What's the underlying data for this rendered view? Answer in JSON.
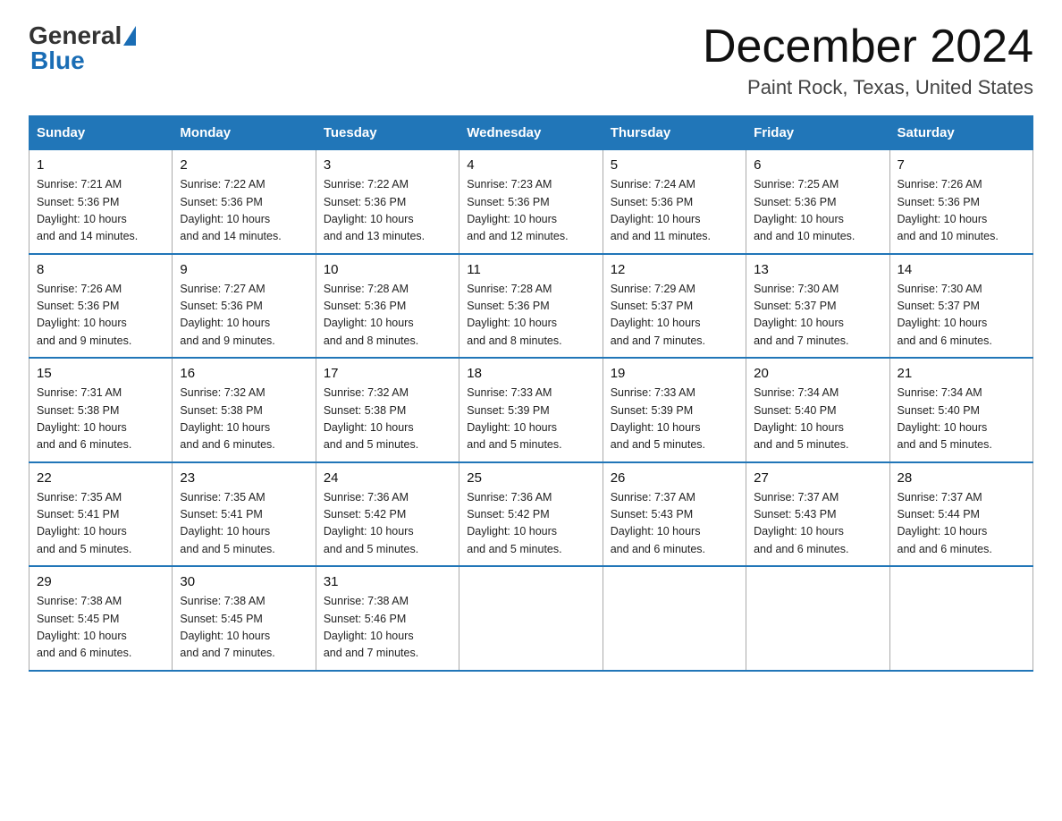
{
  "logo": {
    "text_general": "General",
    "text_blue": "Blue"
  },
  "header": {
    "month": "December 2024",
    "location": "Paint Rock, Texas, United States"
  },
  "weekdays": [
    "Sunday",
    "Monday",
    "Tuesday",
    "Wednesday",
    "Thursday",
    "Friday",
    "Saturday"
  ],
  "weeks": [
    [
      {
        "day": "1",
        "sunrise": "7:21 AM",
        "sunset": "5:36 PM",
        "daylight": "10 hours and 14 minutes."
      },
      {
        "day": "2",
        "sunrise": "7:22 AM",
        "sunset": "5:36 PM",
        "daylight": "10 hours and 14 minutes."
      },
      {
        "day": "3",
        "sunrise": "7:22 AM",
        "sunset": "5:36 PM",
        "daylight": "10 hours and 13 minutes."
      },
      {
        "day": "4",
        "sunrise": "7:23 AM",
        "sunset": "5:36 PM",
        "daylight": "10 hours and 12 minutes."
      },
      {
        "day": "5",
        "sunrise": "7:24 AM",
        "sunset": "5:36 PM",
        "daylight": "10 hours and 11 minutes."
      },
      {
        "day": "6",
        "sunrise": "7:25 AM",
        "sunset": "5:36 PM",
        "daylight": "10 hours and 10 minutes."
      },
      {
        "day": "7",
        "sunrise": "7:26 AM",
        "sunset": "5:36 PM",
        "daylight": "10 hours and 10 minutes."
      }
    ],
    [
      {
        "day": "8",
        "sunrise": "7:26 AM",
        "sunset": "5:36 PM",
        "daylight": "10 hours and 9 minutes."
      },
      {
        "day": "9",
        "sunrise": "7:27 AM",
        "sunset": "5:36 PM",
        "daylight": "10 hours and 9 minutes."
      },
      {
        "day": "10",
        "sunrise": "7:28 AM",
        "sunset": "5:36 PM",
        "daylight": "10 hours and 8 minutes."
      },
      {
        "day": "11",
        "sunrise": "7:28 AM",
        "sunset": "5:36 PM",
        "daylight": "10 hours and 8 minutes."
      },
      {
        "day": "12",
        "sunrise": "7:29 AM",
        "sunset": "5:37 PM",
        "daylight": "10 hours and 7 minutes."
      },
      {
        "day": "13",
        "sunrise": "7:30 AM",
        "sunset": "5:37 PM",
        "daylight": "10 hours and 7 minutes."
      },
      {
        "day": "14",
        "sunrise": "7:30 AM",
        "sunset": "5:37 PM",
        "daylight": "10 hours and 6 minutes."
      }
    ],
    [
      {
        "day": "15",
        "sunrise": "7:31 AM",
        "sunset": "5:38 PM",
        "daylight": "10 hours and 6 minutes."
      },
      {
        "day": "16",
        "sunrise": "7:32 AM",
        "sunset": "5:38 PM",
        "daylight": "10 hours and 6 minutes."
      },
      {
        "day": "17",
        "sunrise": "7:32 AM",
        "sunset": "5:38 PM",
        "daylight": "10 hours and 5 minutes."
      },
      {
        "day": "18",
        "sunrise": "7:33 AM",
        "sunset": "5:39 PM",
        "daylight": "10 hours and 5 minutes."
      },
      {
        "day": "19",
        "sunrise": "7:33 AM",
        "sunset": "5:39 PM",
        "daylight": "10 hours and 5 minutes."
      },
      {
        "day": "20",
        "sunrise": "7:34 AM",
        "sunset": "5:40 PM",
        "daylight": "10 hours and 5 minutes."
      },
      {
        "day": "21",
        "sunrise": "7:34 AM",
        "sunset": "5:40 PM",
        "daylight": "10 hours and 5 minutes."
      }
    ],
    [
      {
        "day": "22",
        "sunrise": "7:35 AM",
        "sunset": "5:41 PM",
        "daylight": "10 hours and 5 minutes."
      },
      {
        "day": "23",
        "sunrise": "7:35 AM",
        "sunset": "5:41 PM",
        "daylight": "10 hours and 5 minutes."
      },
      {
        "day": "24",
        "sunrise": "7:36 AM",
        "sunset": "5:42 PM",
        "daylight": "10 hours and 5 minutes."
      },
      {
        "day": "25",
        "sunrise": "7:36 AM",
        "sunset": "5:42 PM",
        "daylight": "10 hours and 5 minutes."
      },
      {
        "day": "26",
        "sunrise": "7:37 AM",
        "sunset": "5:43 PM",
        "daylight": "10 hours and 6 minutes."
      },
      {
        "day": "27",
        "sunrise": "7:37 AM",
        "sunset": "5:43 PM",
        "daylight": "10 hours and 6 minutes."
      },
      {
        "day": "28",
        "sunrise": "7:37 AM",
        "sunset": "5:44 PM",
        "daylight": "10 hours and 6 minutes."
      }
    ],
    [
      {
        "day": "29",
        "sunrise": "7:38 AM",
        "sunset": "5:45 PM",
        "daylight": "10 hours and 6 minutes."
      },
      {
        "day": "30",
        "sunrise": "7:38 AM",
        "sunset": "5:45 PM",
        "daylight": "10 hours and 7 minutes."
      },
      {
        "day": "31",
        "sunrise": "7:38 AM",
        "sunset": "5:46 PM",
        "daylight": "10 hours and 7 minutes."
      },
      null,
      null,
      null,
      null
    ]
  ],
  "labels": {
    "sunrise": "Sunrise:",
    "sunset": "Sunset:",
    "daylight": "Daylight:"
  }
}
